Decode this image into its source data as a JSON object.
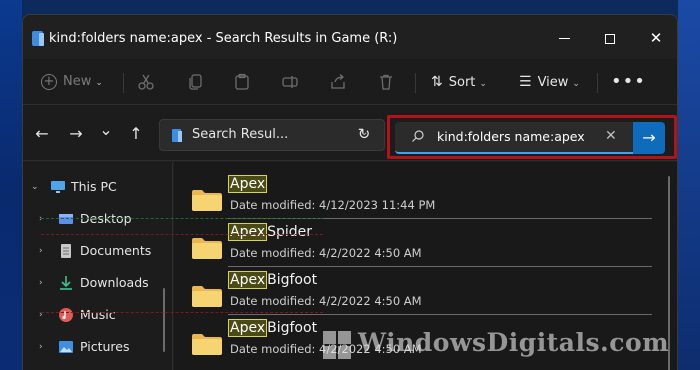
{
  "window": {
    "title": "kind:folders name:apex - Search Results in Game (R:)"
  },
  "window_controls": {
    "minimize": "",
    "maximize": "",
    "close": "✕"
  },
  "toolbar": {
    "new_label": "New",
    "sort_label": "Sort",
    "view_label": "View",
    "more_label": "•••",
    "disabled_icons": [
      "cut-icon",
      "copy-icon",
      "paste-icon",
      "rename-icon",
      "share-icon",
      "delete-icon"
    ]
  },
  "nav": {
    "back": "←",
    "forward": "→",
    "recent": "⌄",
    "up": "↑"
  },
  "address": {
    "text": "Search Resul..."
  },
  "search": {
    "value": "kind:folders name:apex"
  },
  "sidebar": {
    "items": [
      {
        "label": "This PC",
        "icon": "monitor-icon"
      },
      {
        "label": "Desktop",
        "icon": "desktop-icon"
      },
      {
        "label": "Documents",
        "icon": "documents-icon"
      },
      {
        "label": "Downloads",
        "icon": "downloads-icon"
      },
      {
        "label": "Music",
        "icon": "music-icon"
      },
      {
        "label": "Pictures",
        "icon": "pictures-icon"
      }
    ]
  },
  "results": [
    {
      "match": "Apex",
      "rest": "",
      "date": "Date modified: 4/12/2023 11:44 PM"
    },
    {
      "match": "Apex",
      "rest": "Spider",
      "date": "Date modified: 4/2/2022 4:50 AM"
    },
    {
      "match": "Apex",
      "rest": "Bigfoot",
      "date": "Date modified: 4/2/2022 4:50 AM"
    },
    {
      "match": "Apex",
      "rest": "Bigfoot",
      "date": "Date modified: 4/2/2022 4:50 AM"
    }
  ],
  "watermark": {
    "text": "WindowsDigitals.com"
  },
  "colors": {
    "accent": "#0f6cbd",
    "highlight_border": "#b0141a",
    "match_highlight": "#d6d64e",
    "folder": "#f2cf6b"
  }
}
